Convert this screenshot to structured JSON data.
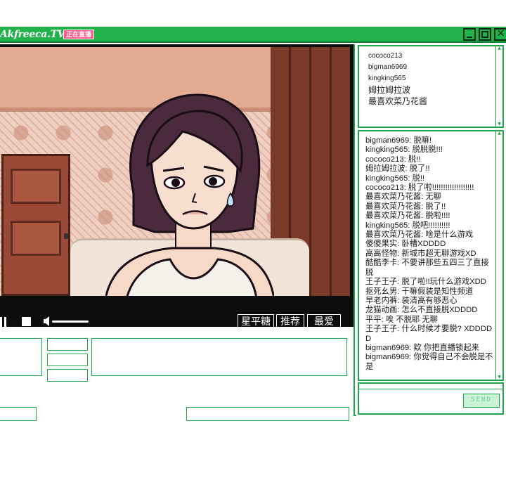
{
  "app": {
    "brand": "Akfreeca.TV",
    "badge": "正在直播"
  },
  "window_controls": {
    "minimize": "",
    "maximize": "",
    "close": "✕"
  },
  "video_controls": {
    "buttons": [
      "星平糖",
      "推荐",
      "最爱"
    ]
  },
  "users": {
    "items": [
      "cococo213",
      "bigman6969",
      "kingking565",
      "姆拉姆拉波",
      "最喜欢菜乃花酱"
    ]
  },
  "chat": {
    "messages": [
      "bigman6969: 脱嘛!",
      "kingking565: 脱脱脱!!!",
      "cococo213: 脱!!",
      "姆拉姆拉波: 脱了!!",
      "kingking565: 脱!!",
      "cococo213: 脱了啦!!!!!!!!!!!!!!!!!!!",
      "最喜欢菜乃花酱: 无聊",
      "最喜欢菜乃花酱: 脱了!!",
      "最喜欢菜乃花酱: 脱啦!!!!",
      "kingking565: 脱吧!!!!!!!!!!",
      "最喜欢菜乃花酱: 啥是什么游戏",
      "傻傻果实: 卧槽XDDDD",
      "高高怪物: 新城市超无聊游戏XD",
      "酷酷李卡: 不要讲那些五四三了直接脱",
      "王子王子: 脱了啦!!玩什么游戏XDD",
      "抠死幺男: 干嘛假装是知性频道",
      "早老内裤: 装清高有够恶心",
      "龙猫动画: 怎么不直接脱XDDDD",
      "平平: 唉 不脱耶 无聊",
      "王子王子: 什么时候才要脱? XDDDDD",
      "bigman6969: 欸 你把直播锁起来",
      "bigman6969: 你觉得自己不会脱是不是"
    ]
  },
  "chat_input": {
    "send_label": "SEND"
  },
  "colors": {
    "accent": "#22b24c",
    "border": "#1ea64a",
    "video_bg": "#0d0d0d"
  }
}
